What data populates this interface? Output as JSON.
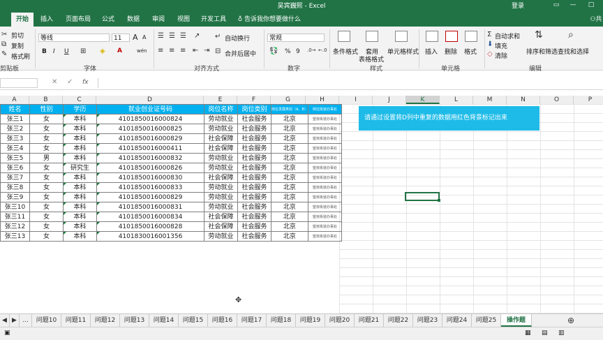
{
  "window": {
    "title": "吴宾巍熙  -  Excel",
    "login": "登录"
  },
  "tabs": [
    "开始",
    "插入",
    "页面布局",
    "公式",
    "数据",
    "审阅",
    "视图",
    "开发工具"
  ],
  "tell_me": "告诉我你想要做什么",
  "share": "共",
  "ribbon": {
    "clipboard": {
      "cut": "剪切",
      "copy": "复制",
      "format_painter": "格式刷",
      "label": "剪贴板"
    },
    "font": {
      "name": "等线",
      "size": "11",
      "bold": "B",
      "italic": "I",
      "underline": "U",
      "grow": "A",
      "shrink": "A",
      "font_color_letter": "A",
      "wen": "wén",
      "label": "字体"
    },
    "alignment": {
      "wrap": "自动换行",
      "merge": "合并后居中",
      "label": "对齐方式"
    },
    "number": {
      "format": "常规",
      "percent": "%",
      "comma": "9",
      "label": "数字"
    },
    "styles": {
      "conditional": "条件格式",
      "as_table_1": "套用",
      "as_table_2": "表格格式",
      "cell_styles": "单元格样式",
      "label": "样式"
    },
    "cells": {
      "insert": "插入",
      "delete": "删除",
      "format": "格式",
      "label": "单元格"
    },
    "editing": {
      "autosum": "自动求和",
      "fill": "填充",
      "clear": "清除",
      "sort": "排序和筛选",
      "find": "查找和选择",
      "label": "编辑"
    }
  },
  "formula_bar": {
    "fx": "fx"
  },
  "columns": [
    "A",
    "B",
    "C",
    "D",
    "E",
    "F",
    "G",
    "H",
    "I",
    "J",
    "K",
    "L",
    "M",
    "N",
    "O",
    "P"
  ],
  "selected_column": "K",
  "table": {
    "headers": [
      "姓名",
      "性别",
      "学历",
      "就业创业证号码",
      "岗位名称",
      "岗位类别",
      "岗位发展类别（A、B）",
      "岗位街道办事处"
    ],
    "rows": [
      [
        "张三1",
        "女",
        "本科",
        "4101850016000824",
        "劳动就业",
        "社会服务",
        "北京",
        "望京街道办事处"
      ],
      [
        "张三2",
        "女",
        "本科",
        "4101850016000825",
        "劳动就业",
        "社会服务",
        "北京",
        "望京街道办事处"
      ],
      [
        "张三3",
        "女",
        "本科",
        "4101850016000829",
        "社会保障",
        "社会服务",
        "北京",
        "望京街道办事处"
      ],
      [
        "张三4",
        "女",
        "本科",
        "4101850016000411",
        "社会保障",
        "社会服务",
        "北京",
        "望京街道办事处"
      ],
      [
        "张三5",
        "男",
        "本科",
        "4101850016000832",
        "劳动就业",
        "社会服务",
        "北京",
        "望京街道办事处"
      ],
      [
        "张三6",
        "女",
        "研究生",
        "4101850016000826",
        "劳动就业",
        "社会服务",
        "北京",
        "望京街道办事处"
      ],
      [
        "张三7",
        "女",
        "本科",
        "4101850016000830",
        "社会保障",
        "社会服务",
        "北京",
        "望京街道办事处"
      ],
      [
        "张三8",
        "女",
        "本科",
        "4101850016000833",
        "劳动就业",
        "社会服务",
        "北京",
        "望京街道办事处"
      ],
      [
        "张三9",
        "女",
        "本科",
        "4101850016000829",
        "劳动就业",
        "社会服务",
        "北京",
        "望京街道办事处"
      ],
      [
        "张三10",
        "女",
        "本科",
        "4101850016000831",
        "劳动就业",
        "社会服务",
        "北京",
        "望京街道办事处"
      ],
      [
        "张三11",
        "女",
        "本科",
        "4101850016000834",
        "社会保障",
        "社会服务",
        "北京",
        "望京街道办事处"
      ],
      [
        "张三12",
        "女",
        "本科",
        "4101850016000828",
        "社会保障",
        "社会服务",
        "北京",
        "望京街道办事处"
      ],
      [
        "张三13",
        "女",
        "本科",
        "4101830016001356",
        "劳动就业",
        "社会服务",
        "北京",
        "望京街道办事处"
      ]
    ]
  },
  "note": "请通过设置将D列中重复的数据用红色背景标记出来",
  "sheets": [
    "...",
    "问题10",
    "问题11",
    "问题12",
    "问题13",
    "问题14",
    "问题15",
    "问题16",
    "问题17",
    "问题18",
    "问题19",
    "问题20",
    "问题21",
    "问题22",
    "问题23",
    "问题24",
    "问题25",
    "操作题"
  ],
  "active_sheet": "操作题",
  "colors": {
    "excel_green": "#217346",
    "header_blue": "#00b0f0",
    "note_blue": "#1ebbe8"
  }
}
